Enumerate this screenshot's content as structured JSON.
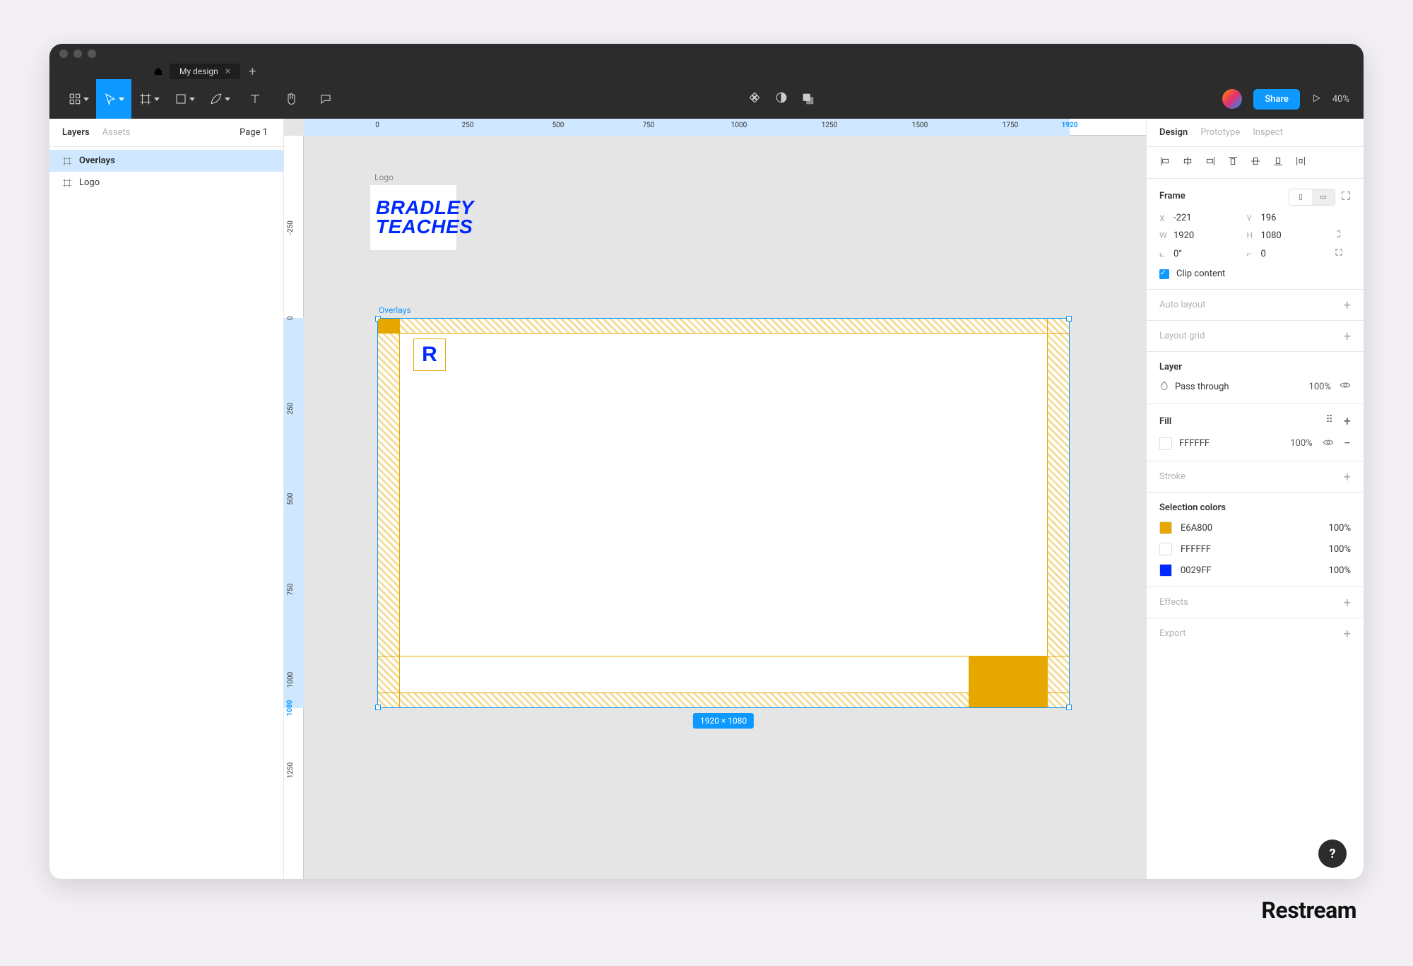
{
  "tabs": {
    "file_name": "My design"
  },
  "toolbar": {
    "share": "Share",
    "zoom": "40%"
  },
  "left_panel": {
    "tab_layers": "Layers",
    "tab_assets": "Assets",
    "page_label": "Page 1",
    "layers": {
      "overlays": "Overlays",
      "logo": "Logo"
    }
  },
  "canvas": {
    "ruler_top": {
      "t0": "0",
      "t250": "250",
      "t500": "500",
      "t750": "750",
      "t1000": "1000",
      "t1250": "1250",
      "t1500": "1500",
      "t1750": "1750",
      "t1920": "1920"
    },
    "ruler_left": {
      "tn250": "-250",
      "t0": "0",
      "t250": "250",
      "t500": "500",
      "t750": "750",
      "t1000": "1000",
      "t1080": "1080",
      "t1250": "1250"
    },
    "logo_label": "Logo",
    "logo_line1": "BRADLEY",
    "logo_line2": "TEACHES",
    "overlays_label": "Overlays",
    "r_badge": "R",
    "dims": "1920 × 1080"
  },
  "right_panel": {
    "tab_design": "Design",
    "tab_prototype": "Prototype",
    "tab_inspect": "Inspect",
    "frame_label": "Frame",
    "x": "-221",
    "y": "196",
    "w": "1920",
    "h": "1080",
    "rotation": "0°",
    "radius": "0",
    "clip": "Clip content",
    "auto_layout": "Auto layout",
    "layout_grid": "Layout grid",
    "layer": "Layer",
    "pass_through": "Pass through",
    "pct100": "100%",
    "fill": "Fill",
    "fill_hex": "FFFFFF",
    "stroke": "Stroke",
    "selection_colors": "Selection colors",
    "c1": "E6A800",
    "c2": "FFFFFF",
    "c3": "0029FF",
    "effects": "Effects",
    "export": "Export"
  },
  "watermark": "Restream",
  "help": "?"
}
